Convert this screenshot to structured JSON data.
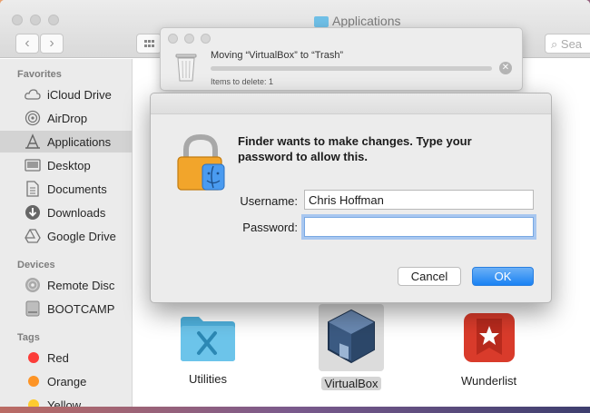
{
  "window": {
    "title": "Applications"
  },
  "toolbar": {
    "back": "‹",
    "forward": "›",
    "search_placeholder": "Sea"
  },
  "sidebar": {
    "favorites_header": "Favorites",
    "favorites": [
      {
        "label": "iCloud Drive",
        "icon": "cloud-icon"
      },
      {
        "label": "AirDrop",
        "icon": "airdrop-icon"
      },
      {
        "label": "Applications",
        "icon": "applications-icon"
      },
      {
        "label": "Desktop",
        "icon": "desktop-icon"
      },
      {
        "label": "Documents",
        "icon": "documents-icon"
      },
      {
        "label": "Downloads",
        "icon": "downloads-icon"
      },
      {
        "label": "Google Drive",
        "icon": "google-drive-icon"
      }
    ],
    "devices_header": "Devices",
    "devices": [
      {
        "label": "Remote Disc",
        "icon": "disc-icon"
      },
      {
        "label": "BOOTCAMP",
        "icon": "drive-icon"
      }
    ],
    "tags_header": "Tags",
    "tags": [
      {
        "label": "Red",
        "color": "#fc3d39"
      },
      {
        "label": "Orange",
        "color": "#fd9426"
      },
      {
        "label": "Yellow",
        "color": "#fecb2f"
      }
    ]
  },
  "content": {
    "apps": [
      {
        "label": "Utilities",
        "icon": "utilities-folder-icon"
      },
      {
        "label": "VirtualBox",
        "icon": "virtualbox-icon"
      },
      {
        "label": "Wunderlist",
        "icon": "wunderlist-icon"
      }
    ]
  },
  "progress": {
    "title": "Moving “VirtualBox” to “Trash”",
    "subtitle": "Items to delete: 1",
    "fraction": 0.0
  },
  "dialog": {
    "message": "Finder wants to make changes. Type your password to allow this.",
    "username_label": "Username:",
    "username_value": "Chris Hoffman",
    "password_label": "Password:",
    "password_value": "",
    "cancel_label": "Cancel",
    "ok_label": "OK"
  },
  "colors": {
    "accent": "#1a82f3",
    "selection": "#d3d3d3"
  }
}
